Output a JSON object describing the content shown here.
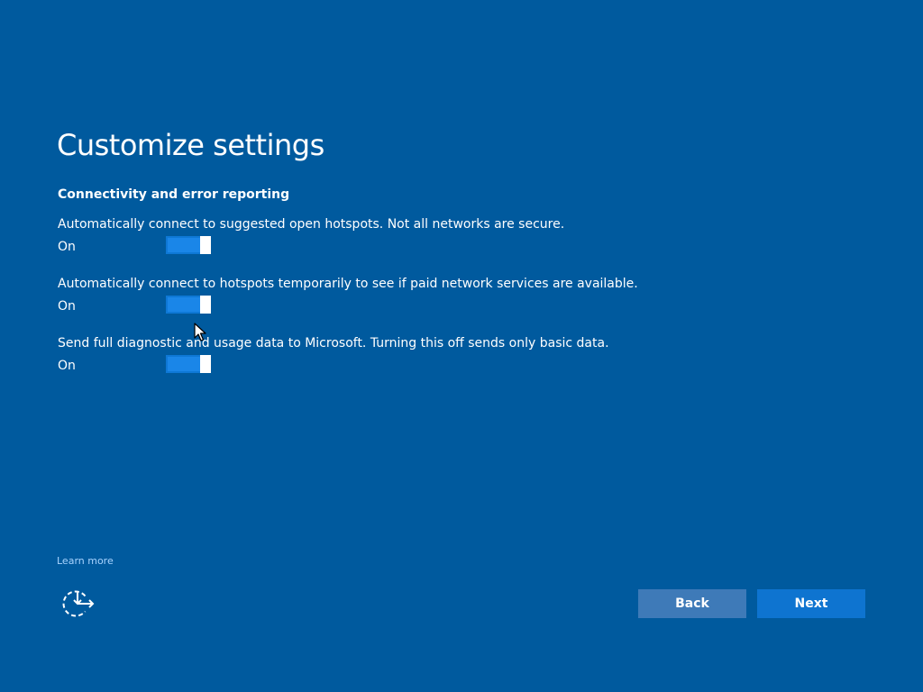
{
  "page": {
    "title": "Customize settings",
    "background_color": "#005a9e"
  },
  "section": {
    "heading": "Connectivity and error reporting"
  },
  "settings": [
    {
      "description": "Automatically connect to suggested open hotspots. Not all networks are secure.",
      "state": "On",
      "on": true
    },
    {
      "description": "Automatically connect to hotspots temporarily to see if paid network services are available.",
      "state": "On",
      "on": true
    },
    {
      "description": "Send full diagnostic and usage data to Microsoft. Turning this off sends only basic data.",
      "state": "On",
      "on": true
    }
  ],
  "footer": {
    "learn_more": "Learn more",
    "accessibility_icon": "ease-of-access-icon",
    "back_label": "Back",
    "next_label": "Next"
  },
  "colors": {
    "toggle_on": "#1a86e8",
    "back_button": "#3e7ab8",
    "next_button": "#0e74d0",
    "link": "#a9d4ff"
  }
}
